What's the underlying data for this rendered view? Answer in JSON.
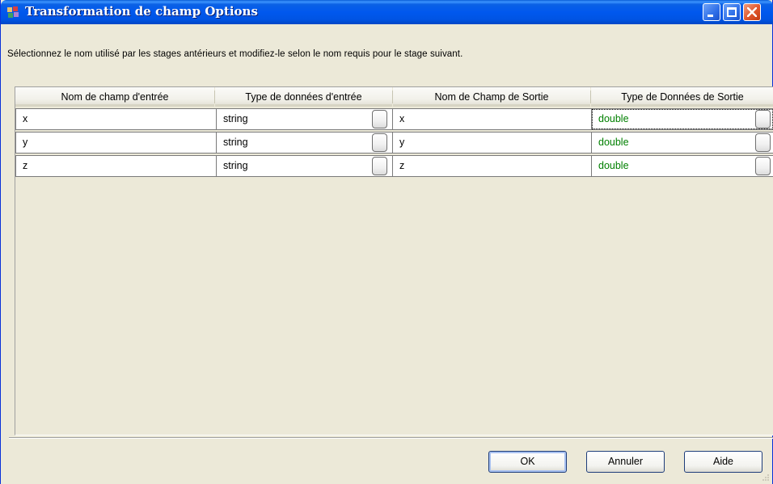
{
  "window": {
    "title": "Transformation de champ Options",
    "controls": {
      "minimize": "minimize",
      "maximize": "maximize",
      "close": "close"
    },
    "title_color": "#0054e3"
  },
  "instruction": "Sélectionnez le nom utilisé par les stages antérieurs et modifiez-le selon le nom requis pour le stage suivant.",
  "grid": {
    "columns": [
      "Nom de champ d'entrée",
      "Type de données d'entrée",
      "Nom de Champ de Sortie",
      "Type de Données de Sortie"
    ],
    "rows": [
      {
        "input_name": "x",
        "input_type": "string",
        "output_name": "x",
        "output_type": "double"
      },
      {
        "input_name": "y",
        "input_type": "string",
        "output_name": "y",
        "output_type": "double"
      },
      {
        "input_name": "z",
        "input_type": "string",
        "output_name": "z",
        "output_type": "double"
      }
    ],
    "output_type_color": "#008000"
  },
  "buttons": {
    "ok": "OK",
    "cancel": "Annuler",
    "help": "Aide"
  }
}
